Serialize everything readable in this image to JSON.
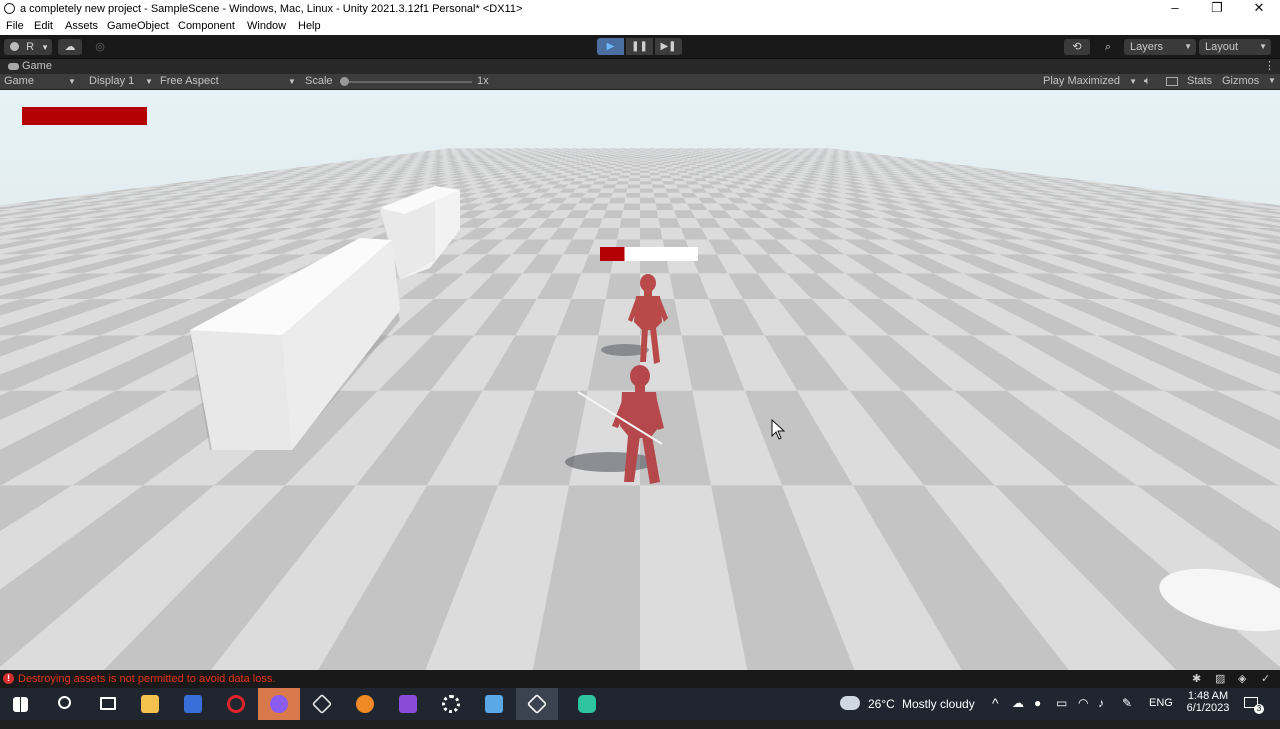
{
  "window": {
    "title": "a completely new project - SampleScene - Windows, Mac, Linux - Unity 2021.3.12f1 Personal* <DX11>"
  },
  "menu": {
    "items": [
      "File",
      "Edit",
      "Assets",
      "GameObject",
      "Component",
      "Window",
      "Help"
    ]
  },
  "toolbar": {
    "account_label": "R",
    "layers_label": "Layers",
    "layout_label": "Layout"
  },
  "game_tab": {
    "label": "Game"
  },
  "game_toolbar": {
    "mode": "Game",
    "display": "Display 1",
    "aspect": "Free Aspect",
    "scale_label": "Scale",
    "scale_value": "1x",
    "play_mode": "Play Maximized",
    "stats": "Stats",
    "gizmos": "Gizmos"
  },
  "hud": {
    "player_health_fraction": 1.0,
    "enemy_health_fraction": 0.25,
    "health_color": "#b50000"
  },
  "status": {
    "message": "Destroying assets is not permitted to avoid data loss.",
    "error_color": "#e0341a"
  },
  "taskbar": {
    "apps": [
      "windows-start-icon",
      "search-icon",
      "task-view-icon",
      "file-explorer-icon",
      "visual-studio-code-icon",
      "opera-icon",
      "messenger-icon",
      "unity-hub-icon",
      "blender-icon",
      "visual-studio-icon",
      "settings-icon",
      "remote-desktop-icon",
      "unity-editor-icon",
      "discord-icon"
    ],
    "weather_temp": "26°C",
    "weather_desc": "Mostly cloudy",
    "language": "ENG",
    "time": "1:48 AM",
    "date": "6/1/2023",
    "notification_count": "3"
  }
}
